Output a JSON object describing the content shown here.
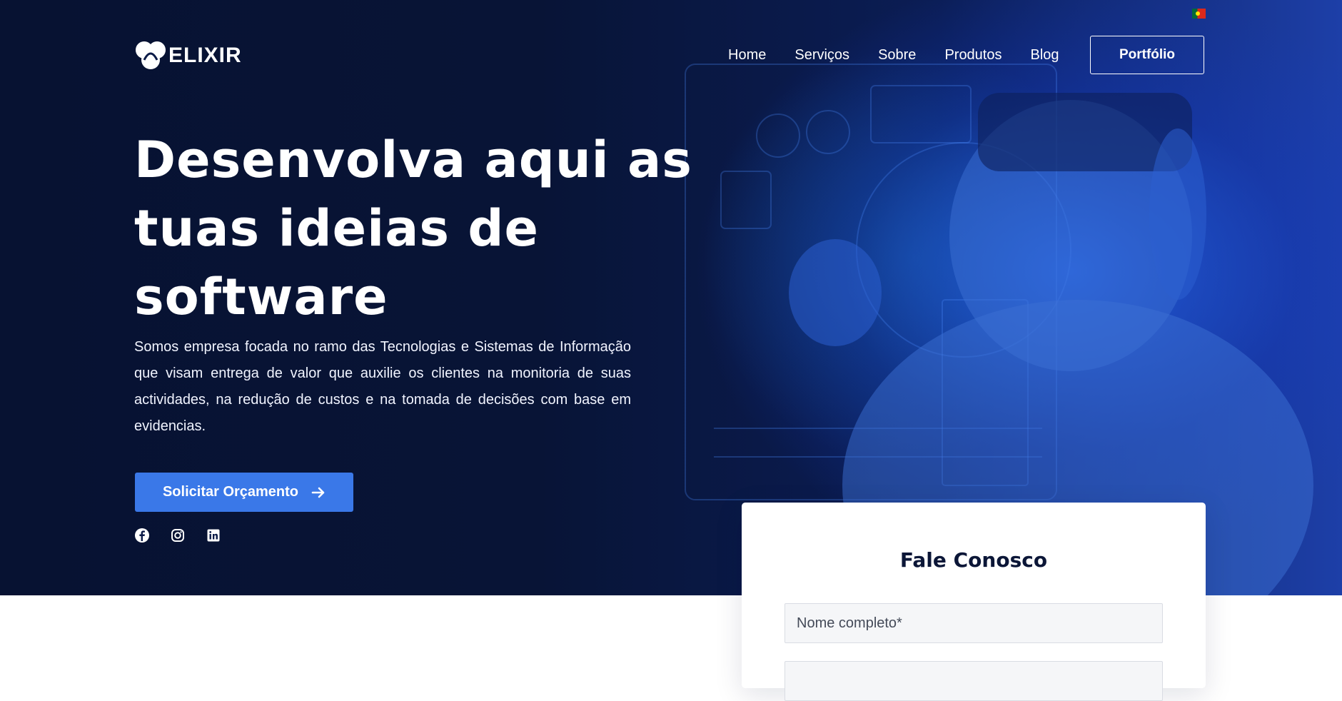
{
  "brand": {
    "name": "ELIXIR"
  },
  "language": {
    "flag": "portugal-flag-icon"
  },
  "nav": {
    "items": [
      {
        "label": "Home"
      },
      {
        "label": "Serviços"
      },
      {
        "label": "Sobre"
      },
      {
        "label": "Produtos"
      },
      {
        "label": "Blog"
      }
    ],
    "cta_label": "Portfólio"
  },
  "hero": {
    "title": "Desenvolva aqui as tuas ideias de software",
    "text": "Somos empresa focada no ramo das Tecnologias e Sistemas de Informação que visam entrega de valor que auxilie os clientes na monitoria de suas actividades, na redução de custos e na tomada de decisões com base em evidencias.",
    "cta_label": "Solicitar Orçamento"
  },
  "social": [
    {
      "icon": "facebook-icon"
    },
    {
      "icon": "instagram-icon"
    },
    {
      "icon": "linkedin-icon"
    }
  ],
  "contact_form": {
    "title": "Fale Conosco",
    "name_placeholder": "Nome completo*"
  },
  "colors": {
    "hero_bg": "#071232",
    "accent": "#3a78e8",
    "white": "#ffffff",
    "heading_dark": "#0b1637"
  }
}
